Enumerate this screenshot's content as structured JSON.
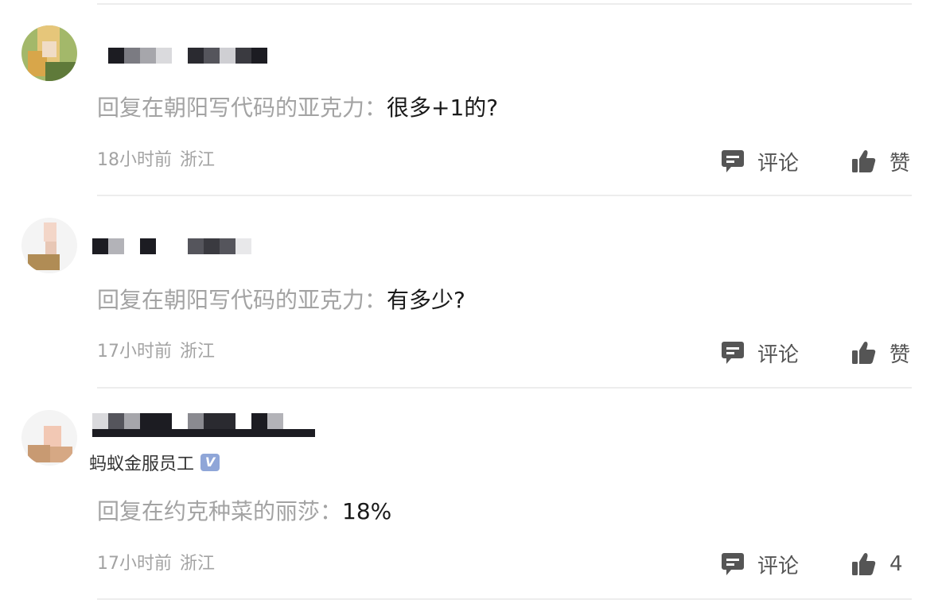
{
  "actions": {
    "comment_label": "评论",
    "like_label": "赞"
  },
  "comments": [
    {
      "reply_prefix": "回复在朝阳写代码的亚克力：",
      "reply_body": "很多+1的?",
      "time": "18小时前",
      "location": "浙江",
      "like_text": "赞"
    },
    {
      "reply_prefix": "回复在朝阳写代码的亚克力：",
      "reply_body": "有多少?",
      "time": "17小时前",
      "location": "浙江",
      "like_text": "赞"
    },
    {
      "badge": "蚂蚁金服员工",
      "badge_icon": "V",
      "reply_prefix": "回复在约克种菜的丽莎：",
      "reply_body": "18%",
      "time": "17小时前",
      "location": "浙江",
      "like_text": "4"
    }
  ],
  "colors": {
    "secondary_text": "#a3a3a3",
    "primary_text": "#1a1a1a",
    "badge_bg": "#8fa6d8",
    "divider": "#ededed",
    "icon": "#555555"
  },
  "icons": {
    "comment": "comment-bubble-icon",
    "like": "thumbs-up-icon"
  }
}
